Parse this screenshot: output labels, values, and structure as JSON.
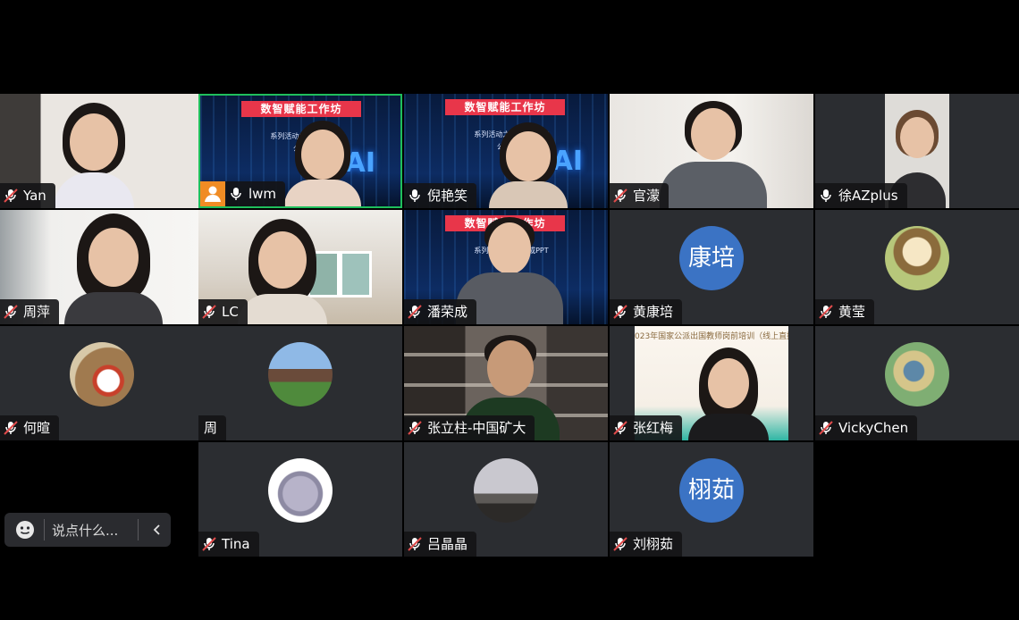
{
  "participants": [
    {
      "name": "Yan",
      "mic": "muted"
    },
    {
      "name": "lwm",
      "mic": "on",
      "sharing": true
    },
    {
      "name": "倪艳笑",
      "mic": "on"
    },
    {
      "name": "官濛",
      "mic": "muted"
    },
    {
      "name": "徐AZplus",
      "mic": "on"
    },
    {
      "name": "周萍",
      "mic": "muted"
    },
    {
      "name": "LC",
      "mic": "muted"
    },
    {
      "name": "潘荣成",
      "mic": "muted"
    },
    {
      "name": "黄康培",
      "mic": "muted",
      "avatar_text": "康培"
    },
    {
      "name": "黄莹",
      "mic": "muted"
    },
    {
      "name": "何暄",
      "mic": "muted"
    },
    {
      "name": "周",
      "mic": "none"
    },
    {
      "name": "张立柱-中国矿大",
      "mic": "muted"
    },
    {
      "name": "张红梅",
      "mic": "muted"
    },
    {
      "name": "VickyChen",
      "mic": "muted"
    },
    {
      "name": "Tina",
      "mic": "muted"
    },
    {
      "name": "吕晶晶",
      "mic": "muted"
    },
    {
      "name": "刘栩茹",
      "mic": "muted",
      "avatar_text": "栩茹"
    }
  ],
  "slide": {
    "banner": "数智赋能工作坊",
    "line1": "系列活动之一",
    "line1_end": "成PPT",
    "line2": "公外研究",
    "ai": "AI"
  },
  "poster": {
    "text": "023年国家公派出国教师岗前培训（线上直播"
  },
  "chat": {
    "placeholder": "说点什么..."
  },
  "colors": {
    "active_border": "#1fbf5c",
    "muted_mic": "#e04b4b",
    "avatar_blue": "#3b73c4",
    "share_badge": "#f08c24"
  }
}
